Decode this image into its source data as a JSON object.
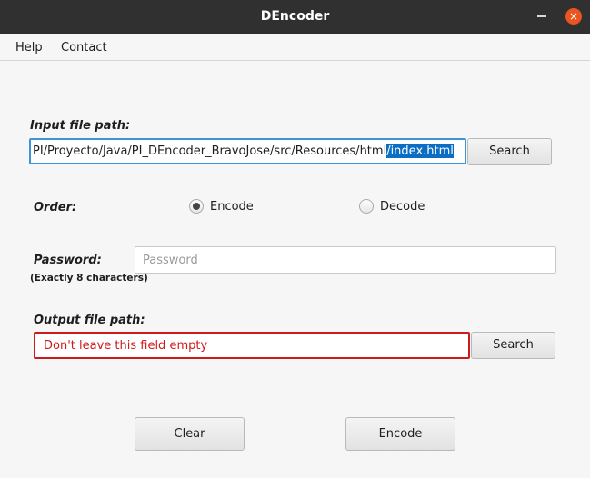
{
  "window": {
    "title": "DEncoder",
    "close_glyph": "×"
  },
  "menu": {
    "items": [
      "Help",
      "Contact"
    ]
  },
  "input": {
    "label": "Input file path:",
    "value_visible": "PI/Proyecto/Java/PI_DEncoder_BravoJose/src/Resources/html",
    "value_selected": "/index.html",
    "search_label": "Search"
  },
  "order": {
    "label": "Order:",
    "options": [
      "Encode",
      "Decode"
    ],
    "selected": "Encode"
  },
  "password": {
    "label": "Password:",
    "hint": "(Exactly 8 characters)",
    "placeholder": "Password",
    "value": ""
  },
  "output": {
    "label": "Output file path:",
    "error_text": "Don't leave this field empty",
    "search_label": "Search",
    "error_color": "#cc1b1b"
  },
  "actions": {
    "clear_label": "Clear",
    "encode_label": "Encode"
  },
  "colors": {
    "accent": "#3d95d9",
    "close": "#e95420",
    "titlebar": "#303030",
    "selection": "#0b6ec4"
  }
}
